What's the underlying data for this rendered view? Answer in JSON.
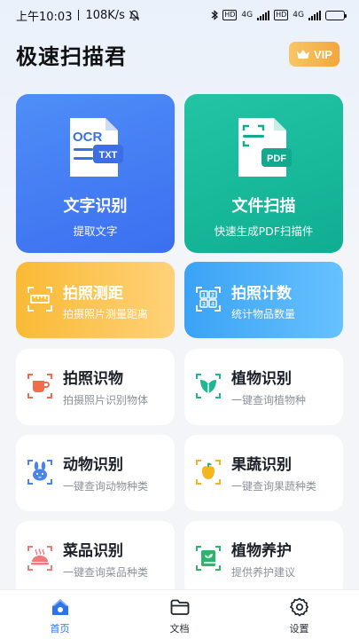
{
  "status_bar": {
    "time": "上午10:03",
    "speed": "108K/s",
    "hd1": "HD",
    "net1": "4G",
    "hd2": "HD",
    "net2": "4G",
    "battery_level": 0.9
  },
  "header": {
    "title": "极速扫描君",
    "vip_label": "VIP"
  },
  "colors": {
    "accent": "#2f73e8",
    "vip": "#f2a73b",
    "ocr_card": "#4580f4",
    "scan_card": "#1ab89c",
    "measure_card": "#fbc24a",
    "count_card": "#4cb1f9"
  },
  "features": {
    "ocr": {
      "title": "文字识别",
      "subtitle": "提取文字",
      "icon": "ocr-document-icon",
      "icon_text": "OCR",
      "icon_badge": "TXT"
    },
    "scan": {
      "title": "文件扫描",
      "subtitle": "快速生成PDF扫描件",
      "icon": "pdf-document-icon",
      "icon_badge": "PDF"
    },
    "measure": {
      "title": "拍照测距",
      "subtitle": "拍摄照片测量距离",
      "icon": "ruler-scan-icon"
    },
    "count": {
      "title": "拍照计数",
      "subtitle": "统计物品数量",
      "icon": "number-grid-scan-icon",
      "digits": [
        "1",
        "2",
        "3",
        "4"
      ]
    },
    "object": {
      "title": "拍照识物",
      "subtitle": "拍摄照片识别物体",
      "icon": "cup-scan-icon"
    },
    "plant": {
      "title": "植物识别",
      "subtitle": "一键查询植物种",
      "icon": "leaf-scan-icon"
    },
    "animal": {
      "title": "动物识别",
      "subtitle": "一键查询动物种类",
      "icon": "rabbit-scan-icon"
    },
    "fruit": {
      "title": "果蔬识别",
      "subtitle": "一键查询果蔬种类",
      "icon": "pepper-scan-icon"
    },
    "dish": {
      "title": "菜品识别",
      "subtitle": "一键查询菜品种类",
      "icon": "dish-scan-icon"
    },
    "care": {
      "title": "植物养护",
      "subtitle": "提供养护建议",
      "icon": "plant-book-icon"
    }
  },
  "tabs": [
    {
      "label": "首页",
      "icon": "home-icon",
      "active": true
    },
    {
      "label": "文档",
      "icon": "folder-icon",
      "active": false
    },
    {
      "label": "设置",
      "icon": "gear-icon",
      "active": false
    }
  ]
}
